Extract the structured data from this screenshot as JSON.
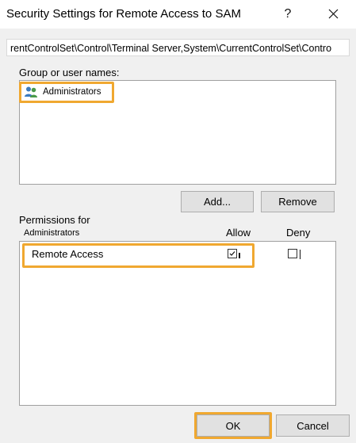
{
  "dialog": {
    "title": "Security Settings for Remote Access to SAM",
    "help_label": "?",
    "object_path": "rentControlSet\\Control\\Terminal Server,System\\CurrentControlSet\\Contro"
  },
  "groups": {
    "label": "Group or user names:",
    "items": [
      {
        "name": "Administrators",
        "icon": "users-group-icon",
        "selected": true
      }
    ],
    "add_label": "Add...",
    "remove_label": "Remove"
  },
  "permissions": {
    "label": "Permissions for",
    "principal": "Administrators",
    "allow_header": "Allow",
    "deny_header": "Deny",
    "rows": [
      {
        "name": "Remote Access",
        "allow": true,
        "deny": false
      }
    ]
  },
  "footer": {
    "ok_label": "OK",
    "cancel_label": "Cancel"
  },
  "colors": {
    "highlight": "#f0a830",
    "dialog_bg": "#f0f0f0",
    "button_bg": "#e1e1e1"
  }
}
